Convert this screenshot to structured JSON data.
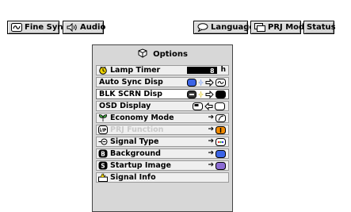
{
  "topbar": {
    "fine_sync": "Fine Sync",
    "audio": "Audio",
    "language": "Language",
    "prj_mode": "PRJ Mode",
    "status": "Status"
  },
  "menu": {
    "title": "Options",
    "items": [
      {
        "label": "Lamp Timer",
        "value": "8",
        "unit": "h"
      },
      {
        "label": "Auto Sync Disp"
      },
      {
        "label": "BLK SCRN Disp",
        "selected": true
      },
      {
        "label": "OSD Display"
      },
      {
        "label": "Economy Mode"
      },
      {
        "label": "PRJ Function",
        "disabled": true
      },
      {
        "label": "Signal Type"
      },
      {
        "label": "Background"
      },
      {
        "label": "Startup Image"
      },
      {
        "label": "Signal Info"
      }
    ]
  },
  "colors": {
    "accent_blue": "#3b64e6",
    "accent_yellow": "#f0d400",
    "accent_orange": "#f08a00"
  }
}
